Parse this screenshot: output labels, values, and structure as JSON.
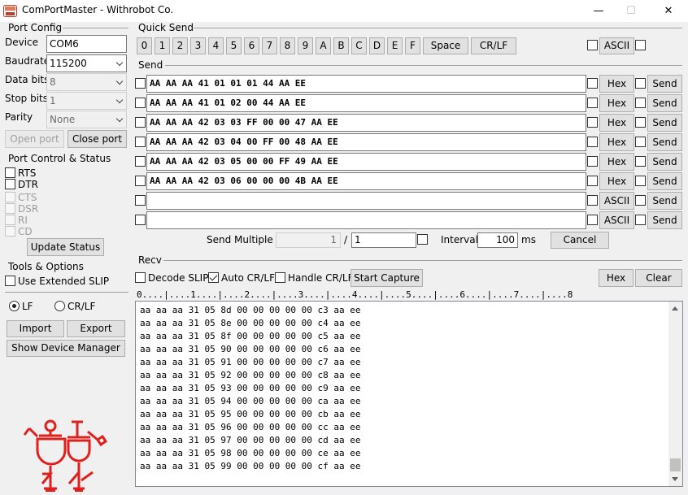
{
  "window": {
    "title": "ComPortMaster - Withrobot Co.",
    "minimize": "—",
    "restore": "☐",
    "close": "✕"
  },
  "port_config": {
    "heading": "Port Config",
    "device_label": "Device",
    "device_value": "COM6",
    "baudrate_label": "Baudrate",
    "baudrate_value": "115200",
    "databits_label": "Data bits",
    "databits_value": "8",
    "stopbits_label": "Stop bits",
    "stopbits_value": "1",
    "parity_label": "Parity",
    "parity_value": "None",
    "open_label": "Open port",
    "close_label": "Close port"
  },
  "port_control": {
    "heading": "Port Control & Status",
    "rts": "RTS",
    "dtr": "DTR",
    "cts": "CTS",
    "dsr": "DSR",
    "ri": "RI",
    "cd": "CD",
    "update_label": "Update Status"
  },
  "tools": {
    "heading": "Tools & Options",
    "extended_slip": "Use Extended SLIP",
    "lf": "LF",
    "crlf": "CR/LF",
    "selected": "LF",
    "import_label": "Import",
    "export_label": "Export",
    "device_manager_label": "Show Device Manager"
  },
  "quick_send": {
    "heading": "Quick Send",
    "keys": [
      "0",
      "1",
      "2",
      "3",
      "4",
      "5",
      "6",
      "7",
      "8",
      "9",
      "A",
      "B",
      "C",
      "D",
      "E",
      "F"
    ],
    "space_label": "Space",
    "crlf_label": "CR/LF",
    "ascii_label": "ASCII"
  },
  "send": {
    "heading": "Send",
    "rows": [
      {
        "text": "AA AA AA 41 01 01 01 44 AA EE",
        "mode": "Hex"
      },
      {
        "text": "AA AA AA 41 01 02 00 44 AA EE",
        "mode": "Hex"
      },
      {
        "text": "AA AA AA 42 03 03 FF 00 00 47 AA EE",
        "mode": "Hex"
      },
      {
        "text": "AA AA AA 42 03 04 00 FF 00 48 AA EE",
        "mode": "Hex"
      },
      {
        "text": "AA AA AA 42 03 05 00 00 FF 49 AA EE",
        "mode": "Hex"
      },
      {
        "text": "AA AA AA 42 03 06 00 00 00 4B AA EE",
        "mode": "Hex"
      },
      {
        "text": "",
        "mode": "ASCII"
      },
      {
        "text": "",
        "mode": "ASCII"
      }
    ],
    "send_label": "Send",
    "multiple_label": "Send Multiple :",
    "multiple_current": "1",
    "separator": "/",
    "multiple_total": "1",
    "interval_label": "Interval",
    "interval_value": "100",
    "interval_unit": "ms",
    "cancel_label": "Cancel"
  },
  "recv": {
    "heading": "Recv",
    "decode_slip": "Decode SLIP",
    "auto_crlf": "Auto CR/LF",
    "handle_crlf": "Handle CR/LF",
    "start_capture": "Start Capture",
    "hex_label": "Hex",
    "clear_label": "Clear",
    "ruler": "0....|....1....|....2....|....3....|....4....|....5....|....6....|....7....|....8",
    "lines": [
      "aa aa aa 31 05 8d 00 00 00 00 00 c3 aa ee",
      "aa aa aa 31 05 8e 00 00 00 00 00 c4 aa ee",
      "aa aa aa 31 05 8f 00 00 00 00 00 c5 aa ee",
      "aa aa aa 31 05 90 00 00 00 00 00 c6 aa ee",
      "aa aa aa 31 05 91 00 00 00 00 00 c7 aa ee",
      "aa aa aa 31 05 92 00 00 00 00 00 c8 aa ee",
      "aa aa aa 31 05 93 00 00 00 00 00 c9 aa ee",
      "aa aa aa 31 05 94 00 00 00 00 00 ca aa ee",
      "aa aa aa 31 05 95 00 00 00 00 00 cb aa ee",
      "aa aa aa 31 05 96 00 00 00 00 00 cc aa ee",
      "aa aa aa 31 05 97 00 00 00 00 00 cd aa ee",
      "aa aa aa 31 05 98 00 00 00 00 00 ce aa ee",
      "aa aa aa 31 05 99 00 00 00 00 00 cf aa ee"
    ]
  },
  "colors": {
    "logo": "#e0201c",
    "scroll_thumb": "#c1c1c1"
  },
  "icons": {
    "app": "com-port-app-icon",
    "logo": "withrobot-logo"
  }
}
